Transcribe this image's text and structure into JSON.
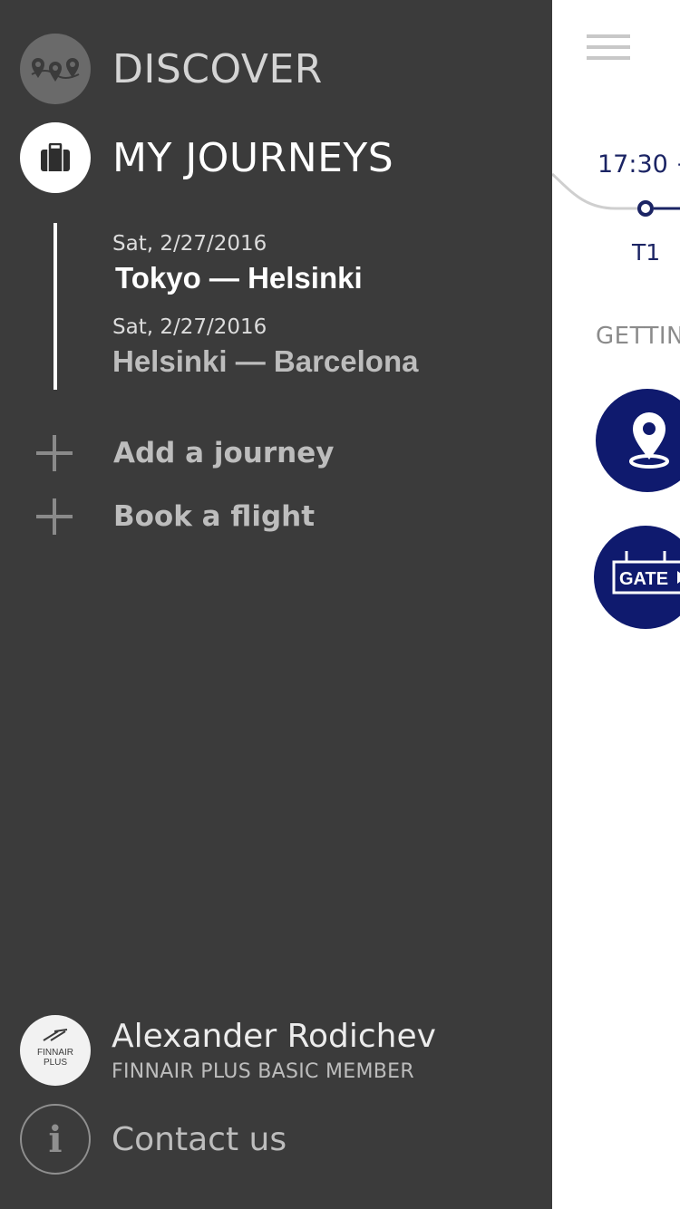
{
  "nav": {
    "discover_label": "DISCOVER",
    "journeys_label": "MY JOURNEYS",
    "discover_icon": "map-pins-icon",
    "journeys_icon": "suitcase-icon"
  },
  "journeys": [
    {
      "date": "Sat, 2/27/2016",
      "route": "Tokyo — Helsinki"
    },
    {
      "date": "Sat, 2/27/2016",
      "route": "Helsinki — Barcelona"
    }
  ],
  "actions": {
    "add_journey": "Add a journey",
    "book_flight": "Book a flight"
  },
  "user": {
    "name": "Alexander Rodichev",
    "tier": "FINNAIR PLUS BASIC MEMBER",
    "badge_line1": "FINNAIR",
    "badge_line2": "PLUS"
  },
  "contact": {
    "label": "Contact us"
  },
  "content": {
    "time": "17:30 +",
    "terminal": "T1",
    "section_heading": "GETTIN",
    "gate_label": "GATE"
  },
  "colors": {
    "drawer_bg": "#3b3b3b",
    "accent_navy": "#0f1a6e",
    "text_primary": "#ffffff",
    "text_muted": "#bdbdbd"
  }
}
